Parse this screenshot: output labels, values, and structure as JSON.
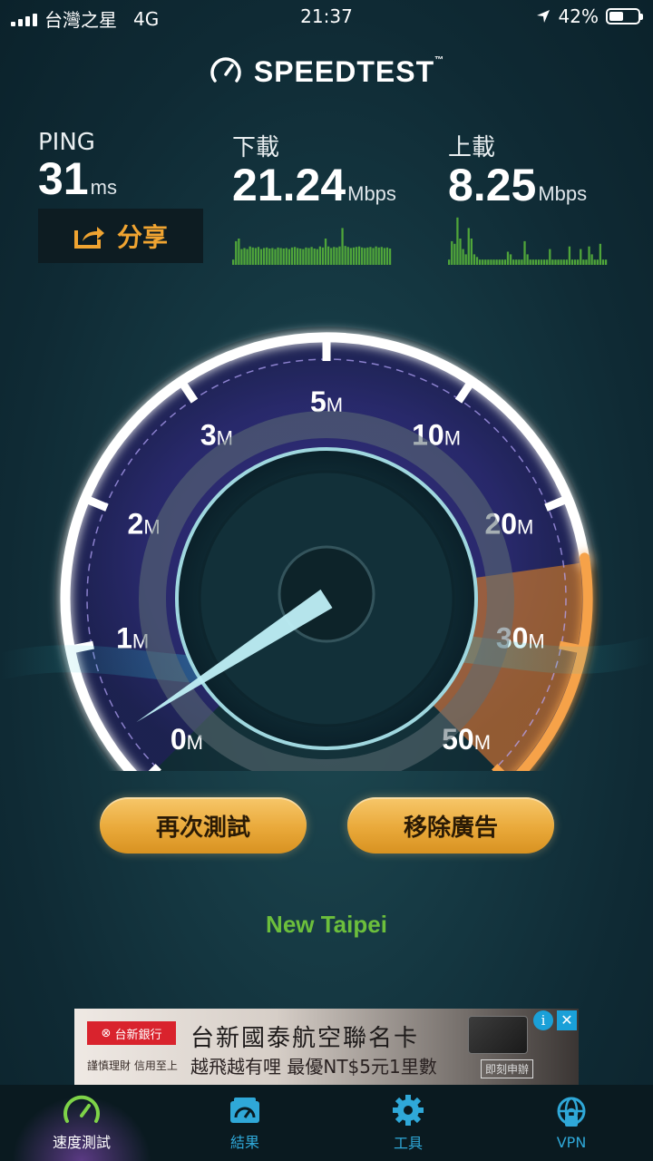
{
  "status_bar": {
    "carrier": "台灣之星",
    "network": "4G",
    "time": "21:37",
    "battery": "42%"
  },
  "app": {
    "title": "SPEEDTEST",
    "trademark": "™"
  },
  "metrics": {
    "ping": {
      "label": "PING",
      "value": "31",
      "unit": "ms"
    },
    "download": {
      "label": "下載",
      "value": "21.24",
      "unit": "Mbps"
    },
    "upload": {
      "label": "上載",
      "value": "8.25",
      "unit": "Mbps"
    }
  },
  "share_label": "分享",
  "gauge": {
    "marks": [
      {
        "num": "0",
        "unit": "M"
      },
      {
        "num": "1",
        "unit": "M"
      },
      {
        "num": "2",
        "unit": "M"
      },
      {
        "num": "3",
        "unit": "M"
      },
      {
        "num": "5",
        "unit": "M"
      },
      {
        "num": "10",
        "unit": "M"
      },
      {
        "num": "20",
        "unit": "M"
      },
      {
        "num": "30",
        "unit": "M"
      },
      {
        "num": "50",
        "unit": "M"
      }
    ],
    "needle_speed_mbps": 0,
    "colors": {
      "arc": "#ffffff",
      "glow": "#a97bff",
      "active": "#f28a1c"
    }
  },
  "buttons": {
    "retest": "再次測試",
    "remove_ads": "移除廣告"
  },
  "location": "New Taipei",
  "ad": {
    "bank": "台新銀行",
    "tagline": "謹慎理財 信用至上",
    "headline": "台新國泰航空聯名卡",
    "line2": "越飛越有哩 最優NT$5元1里數",
    "cta": "即刻申辦"
  },
  "tabs": [
    {
      "label": "速度測試",
      "icon": "speedometer-icon"
    },
    {
      "label": "結果",
      "icon": "results-icon"
    },
    {
      "label": "工具",
      "icon": "gear-icon"
    },
    {
      "label": "VPN",
      "icon": "vpn-globe-icon"
    }
  ],
  "spark_download": [
    0.1,
    0.45,
    0.5,
    0.3,
    0.32,
    0.3,
    0.35,
    0.33,
    0.32,
    0.34,
    0.3,
    0.32,
    0.33,
    0.31,
    0.32,
    0.3,
    0.33,
    0.32,
    0.31,
    0.32,
    0.3,
    0.33,
    0.34,
    0.32,
    0.31,
    0.3,
    0.33,
    0.32,
    0.34,
    0.31,
    0.3,
    0.35,
    0.33,
    0.5,
    0.35,
    0.32,
    0.34,
    0.33,
    0.35,
    0.7,
    0.36,
    0.34,
    0.32,
    0.33,
    0.34,
    0.35,
    0.33,
    0.32,
    0.33,
    0.34,
    0.32,
    0.35,
    0.33,
    0.34,
    0.32,
    0.33,
    0.31
  ],
  "spark_upload": [
    0.1,
    0.45,
    0.4,
    0.9,
    0.5,
    0.3,
    0.2,
    0.7,
    0.5,
    0.2,
    0.15,
    0.1,
    0.1,
    0.1,
    0.1,
    0.1,
    0.1,
    0.1,
    0.1,
    0.1,
    0.1,
    0.25,
    0.2,
    0.1,
    0.1,
    0.1,
    0.1,
    0.45,
    0.2,
    0.1,
    0.1,
    0.1,
    0.1,
    0.1,
    0.1,
    0.1,
    0.3,
    0.1,
    0.1,
    0.1,
    0.1,
    0.1,
    0.1,
    0.35,
    0.1,
    0.1,
    0.1,
    0.3,
    0.1,
    0.1,
    0.35,
    0.2,
    0.1,
    0.1,
    0.4,
    0.1,
    0.1
  ]
}
